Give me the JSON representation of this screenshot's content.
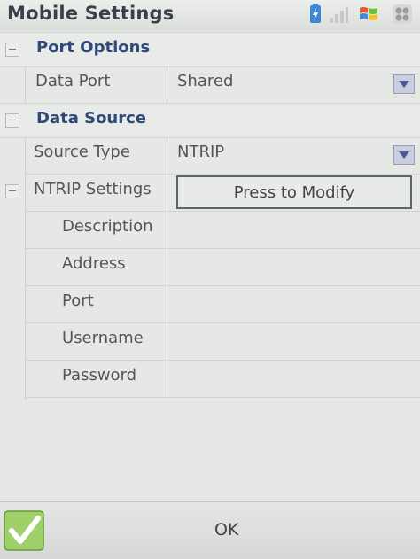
{
  "window": {
    "title": "Mobile Settings"
  },
  "groups": {
    "port_options": {
      "label": "Port Options"
    },
    "data_source": {
      "label": "Data Source"
    }
  },
  "port_options": {
    "data_port": {
      "label": "Data Port",
      "value": "Shared"
    }
  },
  "data_source": {
    "source_type": {
      "label": "Source Type",
      "value": "NTRIP"
    },
    "ntrip_settings": {
      "label": "NTRIP Settings",
      "button_label": "Press to Modify"
    },
    "fields": [
      {
        "label": "Description",
        "value": ""
      },
      {
        "label": "Address",
        "value": ""
      },
      {
        "label": "Port",
        "value": ""
      },
      {
        "label": "Username",
        "value": ""
      },
      {
        "label": "Password",
        "value": ""
      }
    ]
  },
  "footer": {
    "ok_label": "OK"
  },
  "colors": {
    "group_label": "#2e4a7a",
    "dropdown_button": "#c9cfe0",
    "ok_check": "#7cbb3a"
  },
  "icons": [
    "battery-icon",
    "signal-icon",
    "windows-flag-icon",
    "apps-grid-icon",
    "checkmark-icon",
    "dropdown-arrow-icon",
    "collapse-icon"
  ]
}
